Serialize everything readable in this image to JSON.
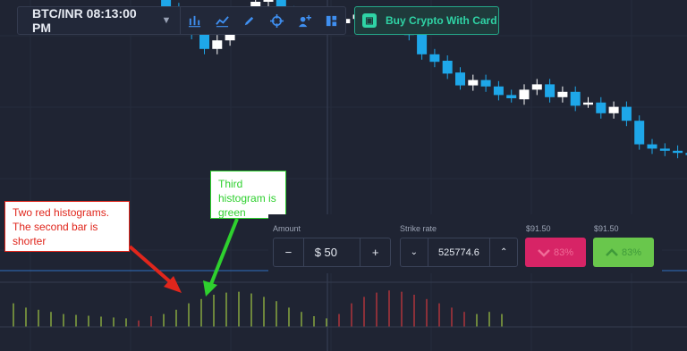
{
  "toolbar": {
    "asset_label": "BTC/INR 08:13:00 PM",
    "icons": [
      "chart-type-icon",
      "indicators-icon",
      "drawing-icon",
      "crosshair-icon",
      "add-alert-icon",
      "layout-icon"
    ]
  },
  "buy_crypto": {
    "label": "Buy Crypto With Card"
  },
  "trade": {
    "amount_label": "Amount",
    "amount_value": "$ 50",
    "minus": "−",
    "plus": "+",
    "strike_label": "Strike rate",
    "strike_value": "525774.6",
    "down_price": "$91.50",
    "up_price": "$91.50",
    "down_percent": "83%",
    "up_percent": "83%"
  },
  "annotations": {
    "red_note": "Two red histograms. The second bar is shorter",
    "green_note": "Third histogram is green"
  },
  "colors": {
    "background": "#1f2433",
    "bull_candle": "#ffffff",
    "bear_candle": "#1ea7e9",
    "hist_red": "#b8363c",
    "hist_green": "#8fb140",
    "annotation_red": "#e0261c",
    "annotation_green": "#2ed02e"
  },
  "chart_data": {
    "type": "candlestick",
    "candles": [
      {
        "o": 0.25,
        "c": 0.275,
        "h": 0.28,
        "l": 0.245
      },
      {
        "o": 0.275,
        "c": 0.288,
        "h": 0.293,
        "l": 0.27
      },
      {
        "o": 0.283,
        "c": 0.292,
        "h": 0.297,
        "l": 0.278
      },
      {
        "o": 0.289,
        "c": 0.299,
        "h": 0.304,
        "l": 0.284
      },
      {
        "o": 0.298,
        "c": 0.293,
        "h": 0.303,
        "l": 0.288
      },
      {
        "o": 0.293,
        "c": 0.272,
        "h": 0.298,
        "l": 0.267
      },
      {
        "o": 0.273,
        "c": 0.248,
        "h": 0.278,
        "l": 0.243
      },
      {
        "o": 0.249,
        "c": 0.222,
        "h": 0.254,
        "l": 0.217
      },
      {
        "o": 0.223,
        "c": 0.197,
        "h": 0.228,
        "l": 0.192
      },
      {
        "o": 0.199,
        "c": 0.166,
        "h": 0.204,
        "l": 0.16
      },
      {
        "o": 0.165,
        "c": 0.124,
        "h": 0.17,
        "l": 0.118
      },
      {
        "o": 0.132,
        "c": 0.103,
        "h": 0.137,
        "l": 0.098
      },
      {
        "o": 0.103,
        "c": 0.084,
        "h": 0.108,
        "l": 0.079
      },
      {
        "o": 0.084,
        "c": 0.072,
        "h": 0.089,
        "l": 0.067
      },
      {
        "o": 0.072,
        "c": 0.06,
        "h": 0.077,
        "l": 0.055
      },
      {
        "o": 0.061,
        "c": 0.046,
        "h": 0.066,
        "l": 0.041
      },
      {
        "o": 0.046,
        "c": 0.054,
        "h": 0.059,
        "l": 0.041
      },
      {
        "o": 0.054,
        "c": 0.067,
        "h": 0.072,
        "l": 0.049
      },
      {
        "o": 0.067,
        "c": 0.08,
        "h": 0.085,
        "l": 0.062
      },
      {
        "o": 0.08,
        "c": 0.09,
        "h": 0.095,
        "l": 0.075
      },
      {
        "o": 0.09,
        "c": 0.094,
        "h": 0.099,
        "l": 0.085
      },
      {
        "o": 0.094,
        "c": 0.081,
        "h": 0.099,
        "l": 0.076
      },
      {
        "o": 0.081,
        "c": 0.073,
        "h": 0.086,
        "l": 0.068
      },
      {
        "o": 0.073,
        "c": 0.07,
        "h": 0.078,
        "l": 0.065
      },
      {
        "o": 0.07,
        "c": 0.078,
        "h": 0.083,
        "l": 0.065
      },
      {
        "o": 0.078,
        "c": 0.07,
        "h": 0.083,
        "l": 0.065
      },
      {
        "o": 0.07,
        "c": 0.074,
        "h": 0.079,
        "l": 0.066
      },
      {
        "o": 0.074,
        "c": 0.078,
        "h": 0.082,
        "l": 0.07
      },
      {
        "o": 0.079,
        "c": 0.075,
        "h": 0.084,
        "l": 0.071
      },
      {
        "o": 0.075,
        "c": 0.076,
        "h": 0.08,
        "l": 0.072
      },
      {
        "o": 0.077,
        "c": 0.079,
        "h": 0.083,
        "l": 0.074
      },
      {
        "o": 0.08,
        "c": 0.059,
        "h": 0.085,
        "l": 0.054
      },
      {
        "o": 0.06,
        "c": 0.041,
        "h": 0.065,
        "l": 0.036
      },
      {
        "o": 0.041,
        "c": 0.034,
        "h": 0.046,
        "l": 0.029
      },
      {
        "o": 0.035,
        "c": 0.023,
        "h": 0.04,
        "l": 0.018
      },
      {
        "o": 0.024,
        "c": 0.012,
        "h": 0.029,
        "l": 0.008
      },
      {
        "o": 0.012,
        "c": 0.017,
        "h": 0.022,
        "l": 0.007
      },
      {
        "o": 0.017,
        "c": 0.011,
        "h": 0.022,
        "l": 0.006
      },
      {
        "o": 0.011,
        "c": 0.003,
        "h": 0.016,
        "l": -0.002
      },
      {
        "o": 0.003,
        "c": 0.0,
        "h": 0.008,
        "l": -0.004
      },
      {
        "o": -0.001,
        "c": 0.008,
        "h": 0.013,
        "l": -0.006
      },
      {
        "o": 0.008,
        "c": 0.013,
        "h": 0.018,
        "l": 0.003
      },
      {
        "o": 0.013,
        "c": 0.001,
        "h": 0.018,
        "l": -0.004
      },
      {
        "o": 0.001,
        "c": 0.006,
        "h": 0.011,
        "l": -0.004
      },
      {
        "o": 0.006,
        "c": -0.007,
        "h": 0.011,
        "l": -0.012
      },
      {
        "o": -0.006,
        "c": -0.004,
        "h": 0.001,
        "l": -0.009
      },
      {
        "o": -0.004,
        "c": -0.014,
        "h": 0.001,
        "l": -0.019
      },
      {
        "o": -0.014,
        "c": -0.008,
        "h": -0.003,
        "l": -0.019
      },
      {
        "o": -0.008,
        "c": -0.021,
        "h": -0.003,
        "l": -0.026
      },
      {
        "o": -0.021,
        "c": -0.043,
        "h": -0.016,
        "l": -0.048
      },
      {
        "o": -0.043,
        "c": -0.047,
        "h": -0.038,
        "l": -0.052
      },
      {
        "o": -0.047,
        "c": -0.049,
        "h": -0.042,
        "l": -0.054
      },
      {
        "o": -0.049,
        "c": -0.051,
        "h": -0.044,
        "l": -0.056
      },
      {
        "o": -0.051,
        "c": -0.053,
        "h": -0.046,
        "l": -0.058
      },
      {
        "o": -0.053,
        "c": -0.061,
        "h": -0.048,
        "l": -0.066
      },
      {
        "o": -0.061,
        "c": -0.079,
        "h": -0.056,
        "l": -0.084
      },
      {
        "o": -0.079,
        "c": -0.081,
        "h": -0.074,
        "l": -0.086
      },
      {
        "o": -0.08,
        "c": -0.079,
        "h": -0.075,
        "l": -0.084
      },
      {
        "o": -0.08,
        "c": -0.088,
        "h": -0.075,
        "l": -0.093
      },
      {
        "o": -0.089,
        "c": -0.1,
        "h": -0.084,
        "l": -0.106
      },
      {
        "o": -0.101,
        "c": -0.11,
        "h": -0.096,
        "l": -0.116
      },
      {
        "o": -0.111,
        "c": -0.119,
        "h": -0.106,
        "l": -0.124
      },
      {
        "o": -0.12,
        "c": -0.123,
        "h": -0.115,
        "l": -0.128
      },
      {
        "o": -0.123,
        "c": -0.127,
        "h": -0.118,
        "l": -0.132
      },
      {
        "o": -0.126,
        "c": -0.124,
        "h": -0.119,
        "l": -0.131
      },
      {
        "o": -0.124,
        "c": -0.119,
        "h": -0.114,
        "l": -0.129
      },
      {
        "o": -0.119,
        "c": -0.1,
        "h": -0.095,
        "l": -0.124
      },
      {
        "o": -0.101,
        "c": -0.095,
        "h": -0.09,
        "l": -0.106
      },
      {
        "o": -0.096,
        "c": -0.102,
        "h": -0.091,
        "l": -0.107
      },
      {
        "o": -0.102,
        "c": -0.097,
        "h": -0.09,
        "l": -0.107
      },
      {
        "o": -0.098,
        "c": -0.088,
        "h": -0.083,
        "l": -0.103
      },
      {
        "o": -0.089,
        "c": -0.106,
        "h": -0.084,
        "l": -0.111
      },
      {
        "o": -0.107,
        "c": -0.113,
        "h": -0.102,
        "l": -0.118
      },
      {
        "o": -0.114,
        "c": -0.112,
        "h": -0.107,
        "l": -0.119
      },
      {
        "o": -0.112,
        "c": -0.116,
        "h": -0.107,
        "l": -0.121
      },
      {
        "o": -0.117,
        "c": -0.121,
        "h": -0.112,
        "l": -0.126
      },
      {
        "o": -0.121,
        "c": -0.132,
        "h": -0.116,
        "l": -0.137
      },
      {
        "o": -0.132,
        "c": -0.14,
        "h": -0.127,
        "l": -0.145
      },
      {
        "o": -0.141,
        "c": -0.143,
        "h": -0.136,
        "l": -0.148
      },
      {
        "o": -0.143,
        "c": -0.146,
        "h": -0.138,
        "l": -0.151
      },
      {
        "o": -0.146,
        "c": -0.146,
        "h": -0.141,
        "l": -0.151
      },
      {
        "o": -0.146,
        "c": -0.149,
        "h": -0.141,
        "l": -0.154
      },
      {
        "o": -0.149,
        "c": -0.152,
        "h": -0.144,
        "l": -0.157
      },
      {
        "o": -0.152,
        "c": -0.154,
        "h": -0.147,
        "l": -0.159
      },
      {
        "o": -0.154,
        "c": -0.151,
        "h": -0.146,
        "l": -0.159
      },
      {
        "o": -0.151,
        "c": -0.153,
        "h": -0.146,
        "l": -0.158
      }
    ],
    "histogram": [
      0.55,
      0.45,
      0.4,
      0.35,
      0.3,
      0.28,
      0.26,
      0.24,
      0.22,
      0.2,
      -0.15,
      -0.25,
      0.3,
      0.4,
      0.55,
      0.65,
      0.75,
      0.8,
      0.82,
      0.78,
      0.7,
      0.6,
      0.45,
      0.35,
      0.25,
      0.2,
      -0.3,
      -0.55,
      -0.7,
      -0.8,
      -0.85,
      -0.82,
      -0.75,
      -0.65,
      -0.55,
      -0.45,
      -0.35,
      0.3,
      0.35,
      0.3
    ]
  }
}
